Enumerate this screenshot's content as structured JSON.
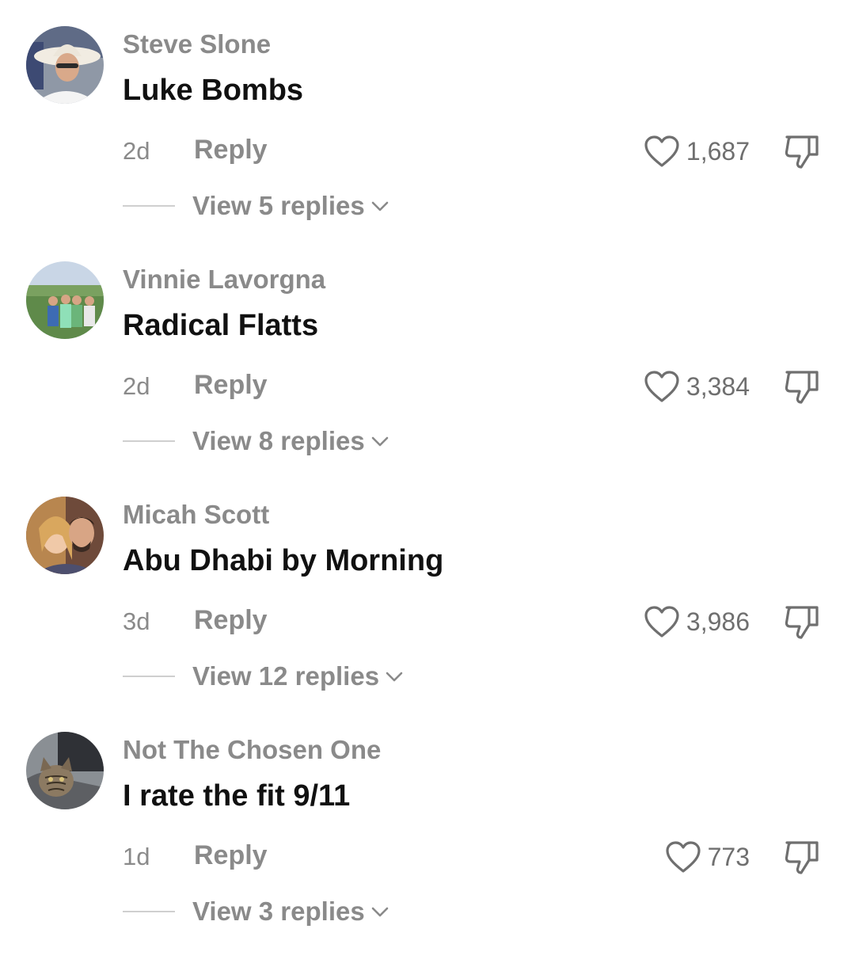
{
  "comments": [
    {
      "username": "Steve Slone",
      "text": "Luke Bombs",
      "time": "2d",
      "reply_label": "Reply",
      "likes": "1,687",
      "view_replies": "View 5 replies",
      "avatar_icon": "avatar-man-cowboy-hat"
    },
    {
      "username": "Vinnie Lavorgna",
      "text": "Radical Flatts",
      "time": "2d",
      "reply_label": "Reply",
      "likes": "3,384",
      "view_replies": "View 8 replies",
      "avatar_icon": "avatar-group-golf-course"
    },
    {
      "username": "Micah Scott",
      "text": "Abu Dhabi by Morning",
      "time": "3d",
      "reply_label": "Reply",
      "likes": "3,986",
      "view_replies": "View 12 replies",
      "avatar_icon": "avatar-couple"
    },
    {
      "username": "Not The Chosen One",
      "text": "I rate the fit 9/11",
      "time": "1d",
      "reply_label": "Reply",
      "likes": "773",
      "view_replies": "View 3 replies",
      "avatar_icon": "avatar-cat"
    }
  ],
  "icons": {
    "like": "heart-outline-icon",
    "dislike": "thumbs-down-outline-icon",
    "expand": "chevron-down-icon"
  },
  "colors": {
    "username": "#8a8a8a",
    "comment_text": "#111111",
    "meta": "#8a8a8a",
    "icon": "#6f6f6f"
  }
}
